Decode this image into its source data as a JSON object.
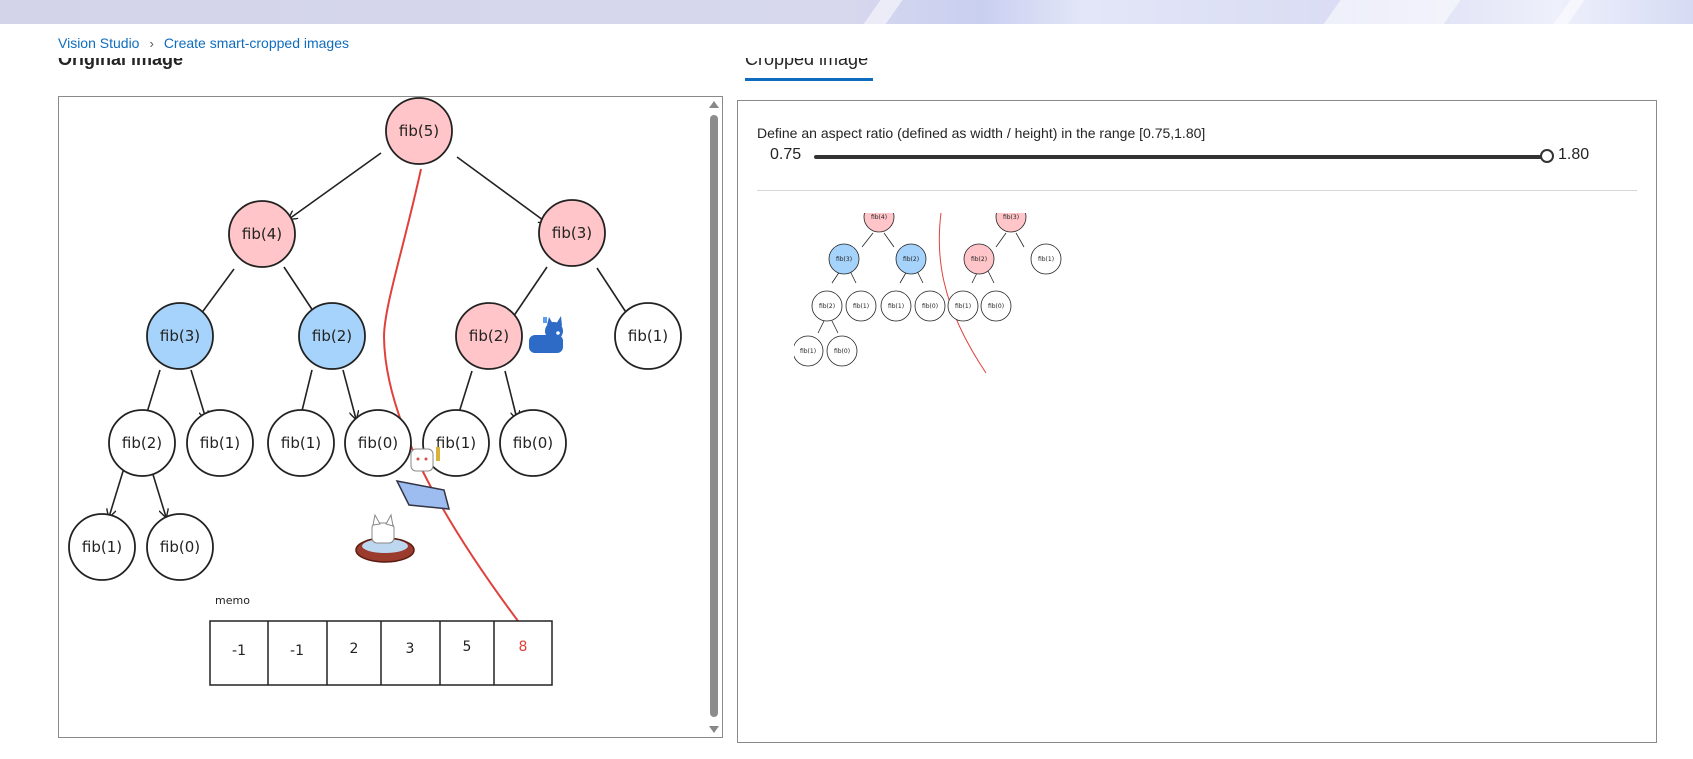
{
  "breadcrumb": {
    "home": "Vision Studio",
    "current": "Create smart-cropped images"
  },
  "sections": {
    "original": "Original image",
    "cropped_tab": "Cropped image"
  },
  "tree": {
    "root": "fib(5)",
    "n_fib4": "fib(4)",
    "n_fib3r": "fib(3)",
    "n_fib3l": "fib(3)",
    "n_fib2m": "fib(2)",
    "n_fib2r": "fib(2)",
    "n_fib1r": "fib(1)",
    "n_fib2ll": "fib(2)",
    "n_fib1a": "fib(1)",
    "n_fib1b": "fib(1)",
    "n_fib0a": "fib(0)",
    "n_fib1c": "fib(1)",
    "n_fib0b": "fib(0)",
    "n_fib1d": "fib(1)",
    "n_fib0c": "fib(0)"
  },
  "memo": {
    "label": "memo",
    "cells": [
      "-1",
      "-1",
      "2",
      "3",
      "5",
      "8"
    ],
    "highlight_color": "#e0413b"
  },
  "slider": {
    "description": "Define an aspect ratio (defined as width / height) in the range [0.75,1.80]",
    "min": "0.75",
    "max": "1.80",
    "value": 1.8
  },
  "colors": {
    "pink": "#ffc5c8",
    "blue": "#a6d3fb",
    "accent": "#0f6cbd",
    "arrow_red": "#e0413b"
  },
  "icons": [
    "cat-icon",
    "cat-in-bed-icon",
    "cat-in-basket-icon"
  ]
}
